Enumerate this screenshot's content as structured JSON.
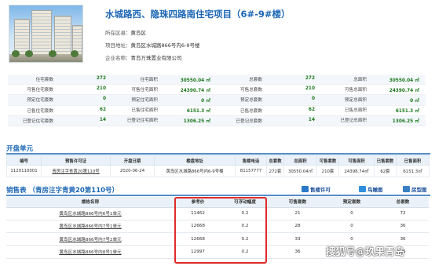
{
  "project": {
    "title": "水城路西、隐珠四路南住宅项目（6#-9#楼）",
    "district_label": "所在区县：",
    "district": "黄岛区",
    "address_label": "项目地址：",
    "address": "黄岛区水城路866号内6-9号楼",
    "company_label": "企业名称：",
    "company": "青岛万珠置业有限公司"
  },
  "stats": [
    [
      {
        "label": "住宅套数",
        "value": "272"
      },
      {
        "label": "住宅面积",
        "value": "30550.04 ㎡"
      },
      {
        "label": "总套数",
        "value": "272"
      },
      {
        "label": "总面积",
        "value": "30550.04 ㎡"
      }
    ],
    [
      {
        "label": "可售住宅套数",
        "value": "210"
      },
      {
        "label": "可售住宅面积",
        "value": "24390.74 ㎡"
      },
      {
        "label": "可售总套数",
        "value": "210"
      },
      {
        "label": "可售总面积",
        "value": "24390.74 ㎡"
      }
    ],
    [
      {
        "label": "预定住宅套数",
        "value": "0"
      },
      {
        "label": "预定住宅面积",
        "value": "0 ㎡"
      },
      {
        "label": "预定总套数",
        "value": "0"
      },
      {
        "label": "预定总面积",
        "value": "0 ㎡"
      }
    ],
    [
      {
        "label": "已售住宅套数",
        "value": "62"
      },
      {
        "label": "已售住宅面积",
        "value": "6151.3 ㎡"
      },
      {
        "label": "已售总套数",
        "value": "62"
      },
      {
        "label": "已售总面积",
        "value": "6151.3 ㎡"
      }
    ],
    [
      {
        "label": "已登记住宅套数",
        "value": "14"
      },
      {
        "label": "已登记住宅面积",
        "value": "1306.25 ㎡"
      },
      {
        "label": "已登记总套数",
        "value": "14"
      },
      {
        "label": "已登记总面积",
        "value": "1306.25 ㎡"
      }
    ]
  ],
  "kaipan": {
    "title": "开盘单元",
    "headers": [
      "编号",
      "预售许可证",
      "开盘日期",
      "楼盘地址",
      "售楼电话",
      "总套数",
      "总面积",
      "可售套数",
      "可售面积",
      "已售套数",
      "已售面积"
    ],
    "row": [
      "1120110001",
      "青房注字青黄20第110号",
      "2020-06-24",
      "黄岛区水城路866号内6-9号楼",
      "81157777",
      "272套",
      "30550.04㎡",
      "210套",
      "24398.74㎡",
      "62套",
      "6151.3㎡"
    ]
  },
  "sales": {
    "title": "销售表 （青房注字青黄20第110号）",
    "tools": [
      "售楼许可",
      "鸟瞰图",
      "房型图"
    ],
    "headers": [
      "楼栋名称",
      "参考价",
      "可浮动幅度",
      "可售套数",
      "预定套数",
      "总套数"
    ],
    "rows": [
      [
        "黄岛区水城路866号内6号1单元",
        "11462",
        "0.2",
        "21",
        "0",
        "72"
      ],
      [
        "黄岛区水城路866号内7号1单元",
        "12668",
        "0.2",
        "28",
        "0",
        "36"
      ],
      [
        "黄岛区水城路866号内7号2单元",
        "12668",
        "0.2",
        "33",
        "0",
        "36"
      ],
      [
        "黄岛区水城路866号内8号1单元",
        "12997",
        "0.2",
        "36",
        "0",
        "36"
      ]
    ]
  },
  "watermark": "搜狐号@玖果青岛"
}
